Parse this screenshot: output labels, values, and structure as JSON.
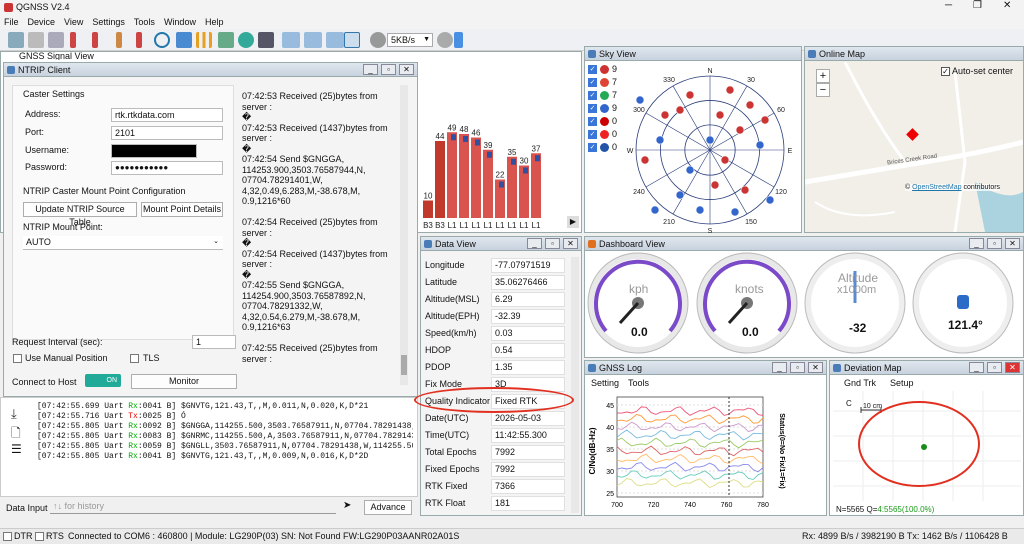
{
  "app": {
    "title": "QGNSS V2.4"
  },
  "menu": [
    "File",
    "Device",
    "View",
    "Settings",
    "Tools",
    "Window",
    "Help"
  ],
  "toolbar": {
    "baud": "5KB/s"
  },
  "signal_view": {
    "title": "GNSS Signal View"
  },
  "ntrip": {
    "title": "NTRIP Client",
    "caster_settings_label": "Caster Settings",
    "address_label": "Address:",
    "address": "rtk.rtkdata.com",
    "port_label": "Port:",
    "port": "2101",
    "username_label": "Username:",
    "password_label": "Password:",
    "password": "●●●●●●●●●●●",
    "mount_config_label": "NTRIP Caster Mount Point Configuration",
    "update_btn": "Update NTRIP Source Table",
    "details_btn": "Mount Point Details",
    "mount_label": "NTRIP Mount Point:",
    "mount_value": "AUTO",
    "interval_label": "Request Interval (sec):",
    "interval_value": "1",
    "manual_pos": "Use Manual Position",
    "tls": "TLS",
    "connect_label": "Connect to Host",
    "toggle": "ON",
    "monitor_btn": "Monitor",
    "log": [
      "07:42:53   Received (25)bytes from server :",
      "�",
      "07:42:53   Received (1437)bytes from server :",
      "�",
      "07:42:54   Send $GNGGA, 114253.900,3503.76587944,N, 07704.78291401,W, 4,32,0.49,6.283,M,-38.678,M, 0.9,1216*60",
      "",
      "07:42:54   Received (25)bytes from server :",
      "�",
      "07:42:54   Received (1437)bytes from server :",
      "�",
      "07:42:55   Send $GNGGA, 114254.900,3503.76587892,N, 07704.78291332,W, 4,32,0.54,6.279,M,-38.678,M, 0.9,1216*63",
      "",
      "07:42:55   Received (25)bytes from server :"
    ]
  },
  "serial_log": [
    {
      "prefix": "[07:42:55.699 Uart ",
      "dir": "Rx",
      "tail": ":0041 B] $GNVTG,121.43,T,,M,0.011,N,0.020,K,D*21"
    },
    {
      "prefix": "[07:42:55.716 Uart ",
      "dir": "Tx",
      "tail": ":0025 B] Ó"
    },
    {
      "prefix": "[07:42:55.805 Uart ",
      "dir": "Rx",
      "tail": ":0092 B] $GNGGA,114255.500,3503.76587911,N,07704.78291438,W,4,3"
    },
    {
      "prefix": "[07:42:55.805 Uart ",
      "dir": "Rx",
      "tail": ":0083 B] $GNRMC,114255.500,A,3503.76587911,N,07704.78291438,W,"
    },
    {
      "prefix": "[07:42:55.805 Uart ",
      "dir": "Rx",
      "tail": ":0059 B] $GNGLL,3503.76587911,N,07704.78291438,W,114255.500,A,D"
    },
    {
      "prefix": "[07:42:55.805 Uart ",
      "dir": "Rx",
      "tail": ":0041 B] $GNVTG,121.43,T,,M,0.009,N,0.016,K,D*2D"
    }
  ],
  "data_input": {
    "label": "Data Input",
    "placeholder": "↑↓ for history",
    "advance_btn": "Advance"
  },
  "bars": {
    "values": [
      10,
      44,
      49,
      48,
      46,
      39,
      22,
      35,
      30,
      37
    ],
    "labels": [
      "B3",
      "B3",
      "L1",
      "L1",
      "L1",
      "L1",
      "L1",
      "L1",
      "L1",
      "L1"
    ]
  },
  "sky_view": {
    "title": "Sky View",
    "counts": [
      "9",
      "7",
      "7",
      "9",
      "0",
      "0",
      "0"
    ],
    "ring_labels": [
      "330",
      "30",
      "60",
      "300",
      "E",
      "W",
      "240",
      "120",
      "210",
      "150",
      "N",
      "S"
    ]
  },
  "online_map": {
    "title": "Online Map",
    "auto_center": "Auto-set center",
    "road": "Brices Creek Road",
    "attribution_prefix": "© ",
    "attribution_link": "OpenStreetMap",
    "attribution_suffix": " contributors"
  },
  "data_view": {
    "title": "Data View",
    "rows": [
      {
        "k": "Longitude",
        "v": "-77.07971519"
      },
      {
        "k": "Latitude",
        "v": "35.06276466"
      },
      {
        "k": "Altitude(MSL)",
        "v": "6.29"
      },
      {
        "k": "Altitude(EPH)",
        "v": "-32.39"
      },
      {
        "k": "Speed(km/h)",
        "v": "0.03"
      },
      {
        "k": "HDOP",
        "v": "0.54"
      },
      {
        "k": "PDOP",
        "v": "1.35"
      },
      {
        "k": "Fix Mode",
        "v": "3D"
      },
      {
        "k": "Quality Indicator",
        "v": "Fixed RTK"
      },
      {
        "k": "Date(UTC)",
        "v": "2026-05-03"
      },
      {
        "k": "Time(UTC)",
        "v": "11:42:55.300"
      },
      {
        "k": "Total Epochs",
        "v": "7992"
      },
      {
        "k": "Fixed Epochs",
        "v": "7992"
      },
      {
        "k": "RTK Fixed",
        "v": "7366"
      },
      {
        "k": "RTK Float",
        "v": "181"
      }
    ]
  },
  "dashboard": {
    "title": "Dashboard View",
    "speed1": {
      "unit": "kph",
      "value": "0.0"
    },
    "speed2": {
      "unit": "knots",
      "value": "0.0"
    },
    "alt": {
      "unit1": "Altitude",
      "unit2": "x1000m",
      "value": "-32"
    },
    "heading": {
      "value": "121.4°"
    }
  },
  "gnss_log": {
    "title": "GNSS Log",
    "menu": [
      "Setting",
      "Tools"
    ],
    "ylabel": "C/No(dB-Hz)",
    "y2label": "Status(0=No Fix/1=Fix)",
    "xticks": [
      "700",
      "720",
      "740",
      "760",
      "780"
    ],
    "yticks": [
      "45",
      "40",
      "35",
      "30",
      "25"
    ]
  },
  "deviation": {
    "title": "Deviation Map",
    "menu": [
      "Gnd Trk",
      "Setup"
    ],
    "scale": "10 cm",
    "c_label": "C",
    "footer_prefix": "N=5565 Q=",
    "footer_value": "4:5565(100.0%)"
  },
  "status": {
    "dtr": "DTR",
    "rts": "RTS",
    "left": "Connected to COM6 : 460800 | Module: LG290P(03)  SN: Not Found  FW:LG290P03AANR02A01S",
    "right": "Rx: 4899 B/s / 3982190 B  Tx: 1462 B/s / 1106428 B"
  }
}
